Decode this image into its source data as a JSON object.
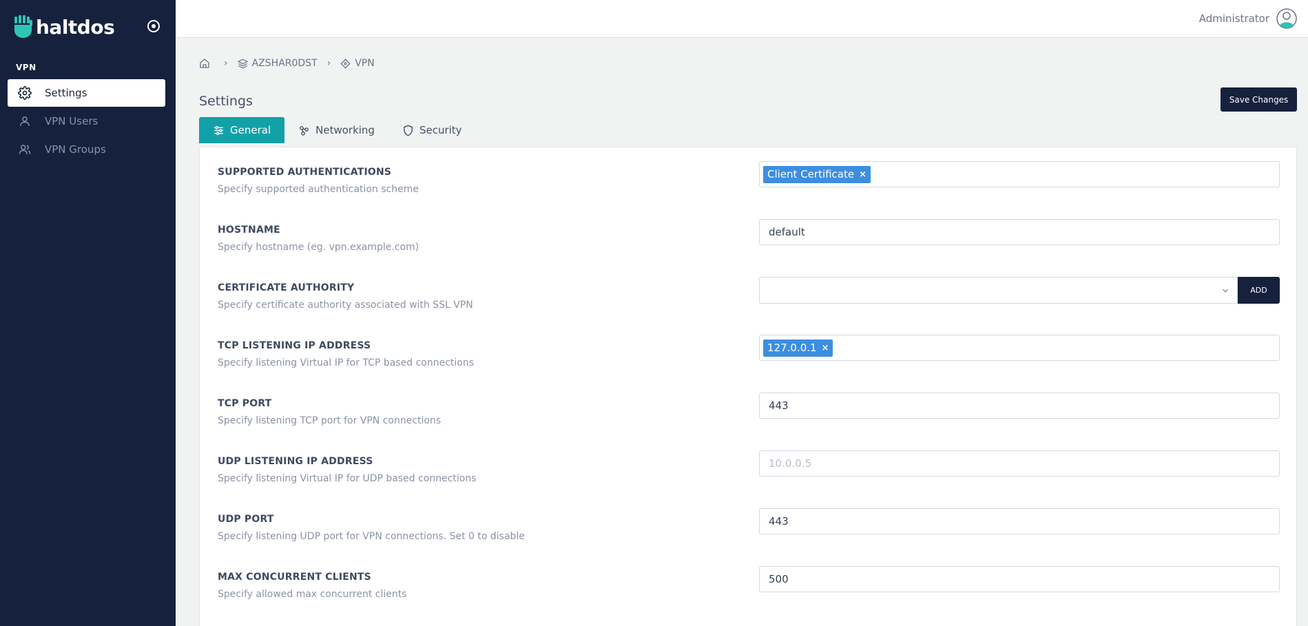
{
  "app": {
    "logo_text": "haltdos",
    "brand_color": "#16213d",
    "accent_color": "#13a1a8",
    "logo_color": "#2ec4b6"
  },
  "sidebar": {
    "section": "VPN",
    "items": [
      {
        "label": "Settings",
        "icon": "gear-icon",
        "active": true
      },
      {
        "label": "VPN Users",
        "icon": "user-icon",
        "active": false
      },
      {
        "label": "VPN Groups",
        "icon": "users-icon",
        "active": false
      }
    ]
  },
  "topbar": {
    "user_name": "Administrator"
  },
  "breadcrumb": {
    "items": [
      "AZSHAR0DST",
      "VPN"
    ]
  },
  "page": {
    "title": "Settings",
    "save_label": "Save Changes"
  },
  "tabs": [
    {
      "label": "General",
      "icon": "sliders-icon",
      "active": true
    },
    {
      "label": "Networking",
      "icon": "network-icon",
      "active": false
    },
    {
      "label": "Security",
      "icon": "shield-icon",
      "active": false
    }
  ],
  "settings": [
    {
      "label": "SUPPORTED AUTHENTICATIONS",
      "description": "Specify supported authentication scheme",
      "type": "tags",
      "tags": [
        "Client Certificate"
      ]
    },
    {
      "label": "HOSTNAME",
      "description": "Specify hostname (eg. vpn.example.com)",
      "type": "text",
      "value": "default"
    },
    {
      "label": "CERTIFICATE AUTHORITY",
      "description": "Specify certificate authority associated with SSL VPN",
      "type": "select",
      "value": "",
      "button": "ADD"
    },
    {
      "label": "TCP LISTENING IP ADDRESS",
      "description": "Specify listening Virtual IP for TCP based connections",
      "type": "tags",
      "tags": [
        "127.0.0.1"
      ]
    },
    {
      "label": "TCP PORT",
      "description": "Specify listening TCP port for VPN connections",
      "type": "text",
      "value": "443"
    },
    {
      "label": "UDP LISTENING IP ADDRESS",
      "description": "Specify listening Virtual IP for UDP based connections",
      "type": "text",
      "value": "",
      "placeholder": "10.0.0.5"
    },
    {
      "label": "UDP PORT",
      "description": "Specify listening UDP port for VPN connections. Set 0 to disable",
      "type": "text",
      "value": "443"
    },
    {
      "label": "MAX CONCURRENT CLIENTS",
      "description": "Specify allowed max concurrent clients",
      "type": "text",
      "value": "500"
    }
  ]
}
